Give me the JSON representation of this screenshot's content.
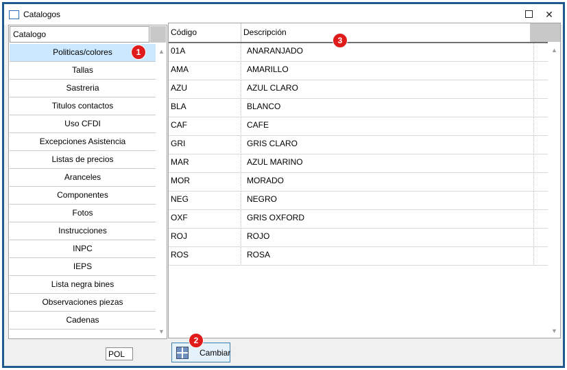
{
  "window": {
    "title": "Catalogos",
    "maximize_icon": "maximize-icon",
    "close_glyph": "✕"
  },
  "catalog": {
    "header": "Catalogo",
    "items": [
      "Politicas/colores",
      "Tallas",
      "Sastreria",
      "Titulos contactos",
      "Uso CFDI",
      "Excepciones Asistencia",
      "Listas de precios",
      "Aranceles",
      "Componentes",
      "Fotos",
      "Instrucciones",
      "INPC",
      "IEPS",
      "Lista negra bines",
      "Observaciones piezas",
      "Cadenas"
    ],
    "selected_index": 0
  },
  "grid": {
    "columns": {
      "codigo": "Código",
      "descripcion": "Descripción"
    },
    "rows": [
      {
        "codigo": "01A",
        "descripcion": "ANARANJADO"
      },
      {
        "codigo": "AMA",
        "descripcion": "AMARILLO"
      },
      {
        "codigo": "AZU",
        "descripcion": "AZUL CLARO"
      },
      {
        "codigo": "BLA",
        "descripcion": "BLANCO"
      },
      {
        "codigo": "CAF",
        "descripcion": "CAFE"
      },
      {
        "codigo": "GRI",
        "descripcion": "GRIS CLARO"
      },
      {
        "codigo": "MAR",
        "descripcion": "AZUL MARINO"
      },
      {
        "codigo": "MOR",
        "descripcion": "MORADO"
      },
      {
        "codigo": "NEG",
        "descripcion": "NEGRO"
      },
      {
        "codigo": "OXF",
        "descripcion": "GRIS OXFORD"
      },
      {
        "codigo": "ROJ",
        "descripcion": "ROJO"
      },
      {
        "codigo": "ROS",
        "descripcion": "ROSA"
      }
    ]
  },
  "footer": {
    "code_value": "POL",
    "change_button": "Cambiar"
  },
  "badges": {
    "one": "1",
    "two": "2",
    "three": "3"
  },
  "colors": {
    "frame": "#1e5a8e",
    "selection": "#cce8ff",
    "badge": "#e01b1b"
  }
}
